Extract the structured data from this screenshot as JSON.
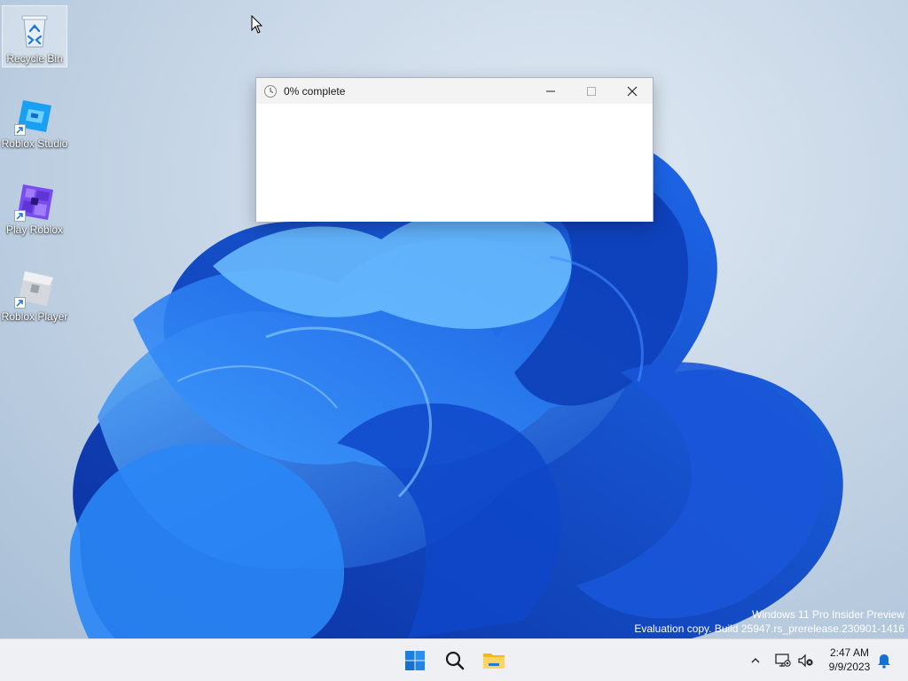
{
  "desktop": {
    "icons": [
      {
        "label": "Recycle Bin",
        "icon": "recycle-bin-icon"
      },
      {
        "label": "Roblox Studio",
        "icon": "roblox-studio-icon"
      },
      {
        "label": "Play Roblox",
        "icon": "play-roblox-icon"
      },
      {
        "label": "Roblox Player",
        "icon": "roblox-player-icon"
      }
    ]
  },
  "progress_window": {
    "title": "0% complete",
    "progress_percent": 0,
    "controls": {
      "minimize": "minimize-icon",
      "maximize": "maximize-icon",
      "close": "close-icon"
    }
  },
  "watermark": {
    "line1": "Windows 11 Pro Insider Preview",
    "line2": "Evaluation copy. Build 25947.rs_prerelease.230901-1416"
  },
  "taskbar": {
    "pinned": [
      "start-icon",
      "search-icon",
      "file-explorer-icon"
    ],
    "tray": [
      "chevron-up-icon",
      "network-icon",
      "volume-muted-icon",
      "notification-bell-icon"
    ],
    "time": "2:47 AM",
    "date": "9/9/2023"
  },
  "colors": {
    "accent": "#0067c0",
    "taskbar_bg": "#eef0f4",
    "bloom_dark": "#0a3db8",
    "bloom_light": "#4aa3ff"
  }
}
